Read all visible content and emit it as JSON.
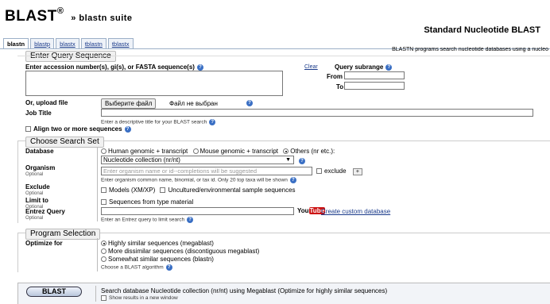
{
  "header": {
    "title": "BLAST",
    "reg": "®",
    "sep": "»",
    "suite": "blastn suite",
    "page_title": "Standard Nucleotide BLAST"
  },
  "tabs": [
    "blastn",
    "blastp",
    "blastx",
    "tblastn",
    "tblastx"
  ],
  "program_description": "BLASTN programs search nucleotide databases using a nucleo",
  "query": {
    "legend": "Enter Query Sequence",
    "accession_label": "Enter accession number(s), gi(s), or FASTA sequence(s)",
    "clear": "Clear",
    "subrange_label": "Query subrange",
    "from_label": "From",
    "to_label": "To",
    "upload_label": "Or, upload file",
    "choose_file": "Выберите файл",
    "no_file": "Файл не выбран",
    "job_title_label": "Job Title",
    "job_title_hint": "Enter a descriptive title for your BLAST search",
    "align_two": "Align two or more sequences"
  },
  "search_set": {
    "legend": "Choose Search Set",
    "database_label": "Database",
    "db_options": [
      "Human genomic + transcript",
      "Mouse genomic + transcript",
      "Others (nr etc.):"
    ],
    "db_selected": "Nucleotide collection (nr/nt)",
    "organism_label": "Organism",
    "optional": "Optional",
    "organism_placeholder": "Enter organism name or id--completions will be suggested",
    "exclude_check": "exclude",
    "plus": "+",
    "organism_hint": "Enter organism common name, binomial, or tax id. Only 20 top taxa will be shown",
    "exclude_label": "Exclude",
    "exclude_models": "Models (XM/XP)",
    "exclude_uncultured": "Uncultured/environmental sample sequences",
    "limit_label": "Limit to",
    "limit_type": "Sequences from type material",
    "entrez_label": "Entrez Query",
    "youtube_you": "You",
    "youtube_tube": "Tube",
    "create_db": "Create custom database",
    "entrez_hint": "Enter an Entrez query to limit search"
  },
  "program": {
    "legend": "Program Selection",
    "optimize_label": "Optimize for",
    "options": [
      "Highly similar sequences (megablast)",
      "More dissimilar sequences (discontiguous megablast)",
      "Somewhat similar sequences (blastn)"
    ],
    "choose_algo": "Choose a BLAST algorithm"
  },
  "footer": {
    "blast_button": "BLAST",
    "summary": "Search database Nucleotide collection (nr/nt) using Megablast (Optimize for highly similar sequences)",
    "new_window": "Show results in a new window"
  },
  "colors": {
    "link": "#1a3a8a",
    "help": "#3a6fc4",
    "youtube_red": "#cc1111"
  }
}
